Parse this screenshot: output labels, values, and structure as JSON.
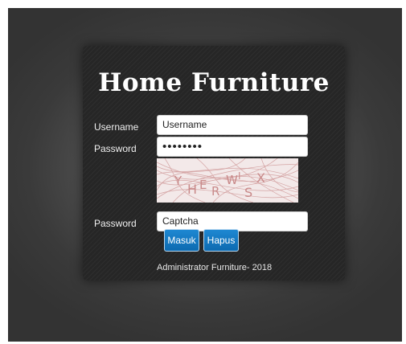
{
  "title": "Home Furniture",
  "form": {
    "username_label": "Username",
    "username_value": "Username",
    "password_label": "Password",
    "password_value": "••••••••",
    "captcha_label": "Password",
    "captcha_image_text": [
      "Y",
      "H",
      "E",
      "R",
      "W",
      "I",
      "S",
      "X"
    ],
    "captcha_value": "Captcha",
    "submit_label": "Masuk",
    "reset_label": "Hapus"
  },
  "footer": "Administrator Furniture- 2018",
  "colors": {
    "card_bg": "#262626",
    "button_bg": "#1479c4",
    "captcha_bg": "#f3e9e9",
    "captcha_ink": "#c98a8a"
  }
}
